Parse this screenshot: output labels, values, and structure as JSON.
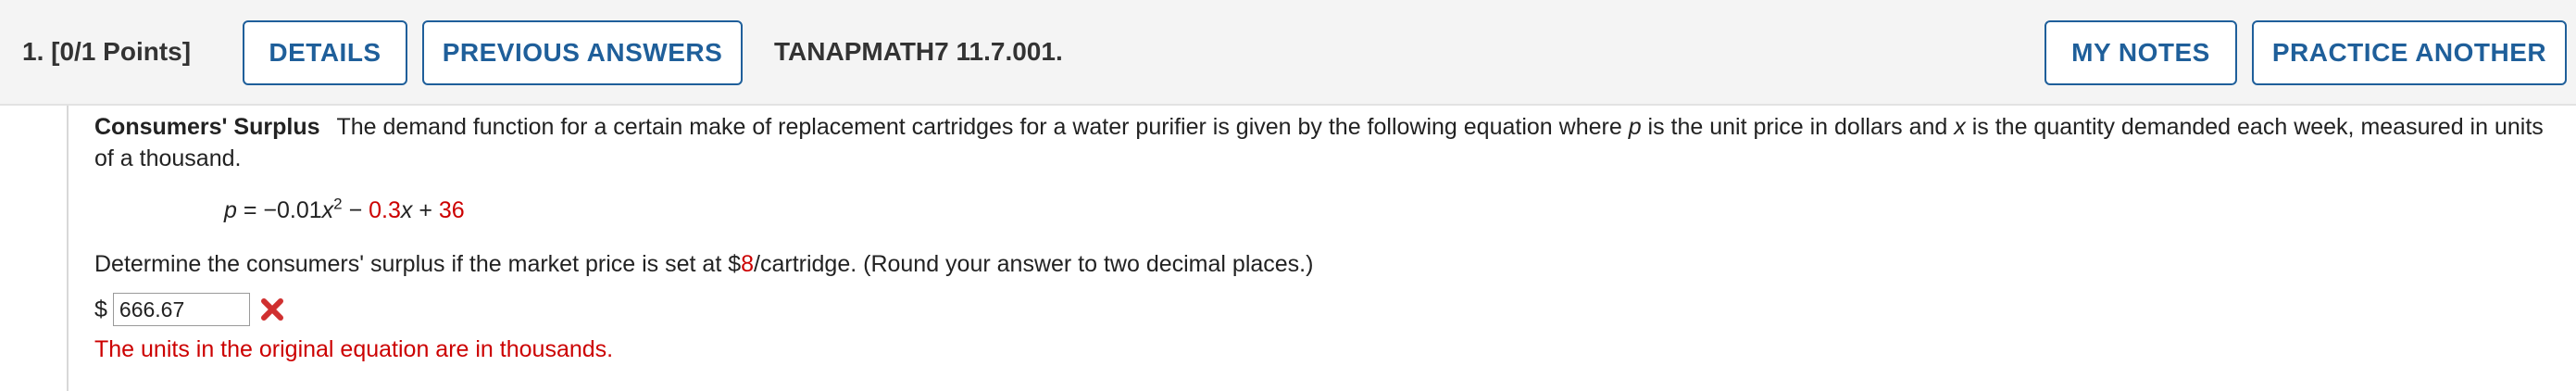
{
  "header": {
    "question_label": "1.  [0/1 Points]",
    "details_label": "DETAILS",
    "previous_answers_label": "PREVIOUS ANSWERS",
    "problem_id": "TANAPMATH7 11.7.001.",
    "my_notes_label": "MY NOTES",
    "practice_another_label": "PRACTICE ANOTHER"
  },
  "problem": {
    "title": "Consumers' Surplus",
    "intro_1": "The demand function for a certain make of replacement cartridges for a water purifier is given by the following equation where ",
    "var_p": "p",
    "intro_2": " is the unit price in dollars and ",
    "var_x": "x",
    "intro_3": " is the quantity demanded each week, measured in units of a thousand.",
    "equation": {
      "lhs": "p",
      "equals": " = −0.01",
      "x1": "x",
      "exponent": "2",
      "minus": " − ",
      "coef": "0.3",
      "x2": "x",
      "plus": " + ",
      "constant": "36"
    },
    "question_1": "Determine the consumers' surplus if the market price is set at $",
    "price": "8",
    "question_2": "/cartridge. (Round your answer to two decimal places.)",
    "currency": "$",
    "answer_value": "666.67",
    "feedback": "The units in the original equation are in thousands."
  },
  "colors": {
    "accent": "#1f5f9a",
    "error": "#cc0000",
    "header_bg": "#f4f4f4"
  },
  "icons": {
    "answer_status": "incorrect-x-icon"
  }
}
